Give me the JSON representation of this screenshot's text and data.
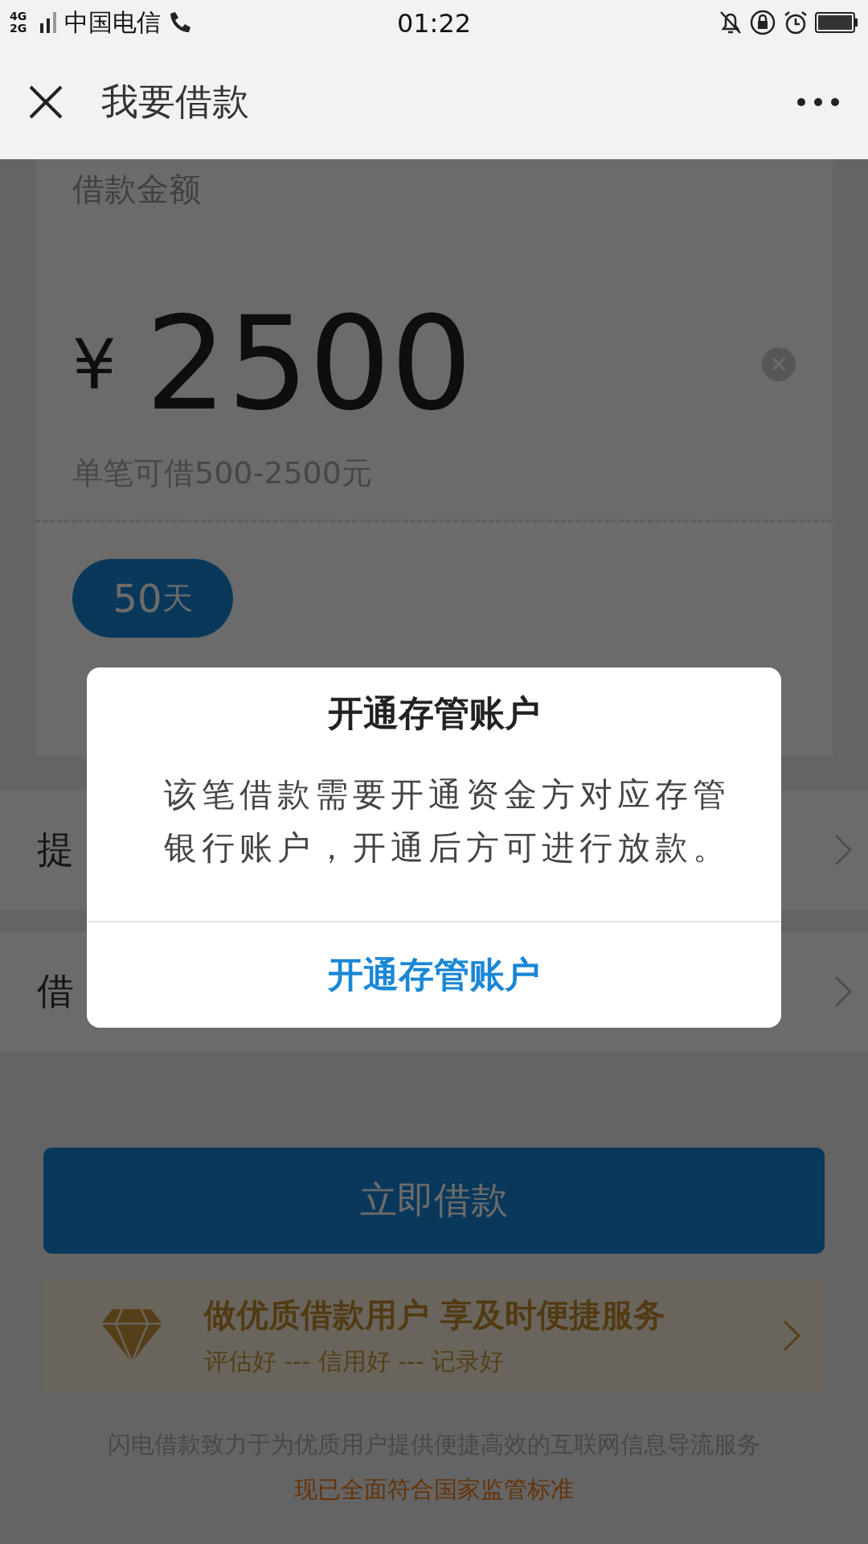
{
  "status_bar": {
    "network": "4G 2G",
    "carrier": "中国电信",
    "time": "01:22"
  },
  "header": {
    "title": "我要借款"
  },
  "loan": {
    "label": "借款金额",
    "currency": "¥",
    "amount": "2500",
    "hint": "单笔可借500-2500元",
    "terms": [
      {
        "value": "50",
        "unit": "天",
        "selected": true
      }
    ]
  },
  "rows": [
    {
      "label": "提"
    },
    {
      "label": "借"
    }
  ],
  "submit": {
    "label": "立即借款"
  },
  "banner": {
    "title": "做优质借款用户 享及时便捷服务",
    "subtitle": "评估好 --- 信用好 --- 记录好"
  },
  "footer": {
    "text": "闪电借款致力于为优质用户提供便捷高效的互联网信息导流服务",
    "notice": "现已全面符合国家监管标准"
  },
  "dialog": {
    "title": "开通存管账户",
    "message": "该笔借款需要开通资金方对应存管银行账户，开通后方可进行放款。",
    "action": "开通存管账户"
  }
}
